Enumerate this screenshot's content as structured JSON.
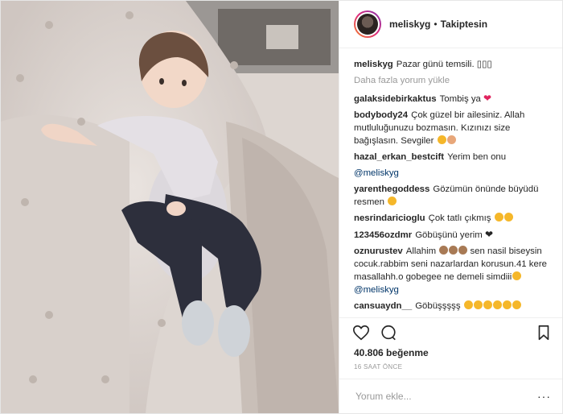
{
  "post": {
    "username": "meliskyg",
    "separator": "•",
    "follow_label": "Takiptesin",
    "caption_user": "meliskyg",
    "caption_text": "Pazar günü temsili. ▯▯▯",
    "load_more": "Daha fazla yorum yükle",
    "likes": "40.806 beğenme",
    "time": "16 SAAT ÖNCE",
    "comment_placeholder": "Yorum ekle...",
    "more_options": "···"
  },
  "comments": [
    {
      "user": "galaksidebirkaktus",
      "text": "Tombiş ya"
    },
    {
      "user": "bodybody24",
      "text": "Çok güzel bir ailesiniz. Allah mutluluğunuzu bozmasın. Kızınızı size bağışlasın. Sevgiler"
    },
    {
      "user": "hazal_erkan_bestcift",
      "text": "Yerim ben onu"
    },
    {
      "mention": "@meliskyg"
    },
    {
      "user": "yarenthegoddess",
      "text": "Gözümün önünde büyüdü resmen"
    },
    {
      "user": "nesrindaricioglu",
      "text": "Çok tatlı çıkmış"
    },
    {
      "user": "123456ozdmr",
      "text": "Göbüşünü yerim"
    },
    {
      "user": "oznurustev",
      "text": "Allahim",
      "text2": "sen nasil biseysin cocuk.rabbim seni nazarlardan korusun.41 kere masallahh.o gobegee ne demeli simdiii",
      "mention": "@meliskyg"
    },
    {
      "user": "cansuaydn__",
      "text": "Göbüşşşşş"
    }
  ],
  "colors": {
    "heart": "#e0245e",
    "emoji": "#f5b72a",
    "link": "#003569"
  },
  "icons": [
    "heart-outline-icon",
    "comment-icon",
    "bookmark-icon"
  ]
}
